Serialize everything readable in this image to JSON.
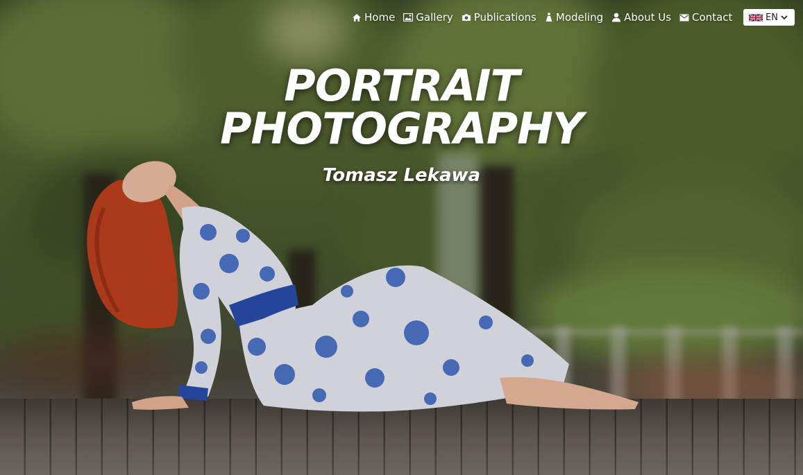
{
  "nav": {
    "items": [
      {
        "label": "Home",
        "icon": "home-icon"
      },
      {
        "label": "Gallery",
        "icon": "image-icon"
      },
      {
        "label": "Publications",
        "icon": "camera-icon"
      },
      {
        "label": "Modeling",
        "icon": "figure-icon"
      },
      {
        "label": "About Us",
        "icon": "person-icon"
      },
      {
        "label": "Contact",
        "icon": "mail-icon"
      }
    ]
  },
  "language": {
    "code": "EN",
    "flag": "uk-flag-icon"
  },
  "hero": {
    "title_line1": "PORTRAIT",
    "title_line2": "PHOTOGRAPHY",
    "subtitle": "Tomasz Lekawa"
  },
  "colors": {
    "text": "#ffffff",
    "dress_blue": "#2a4fb0",
    "hair": "#c0391a"
  }
}
